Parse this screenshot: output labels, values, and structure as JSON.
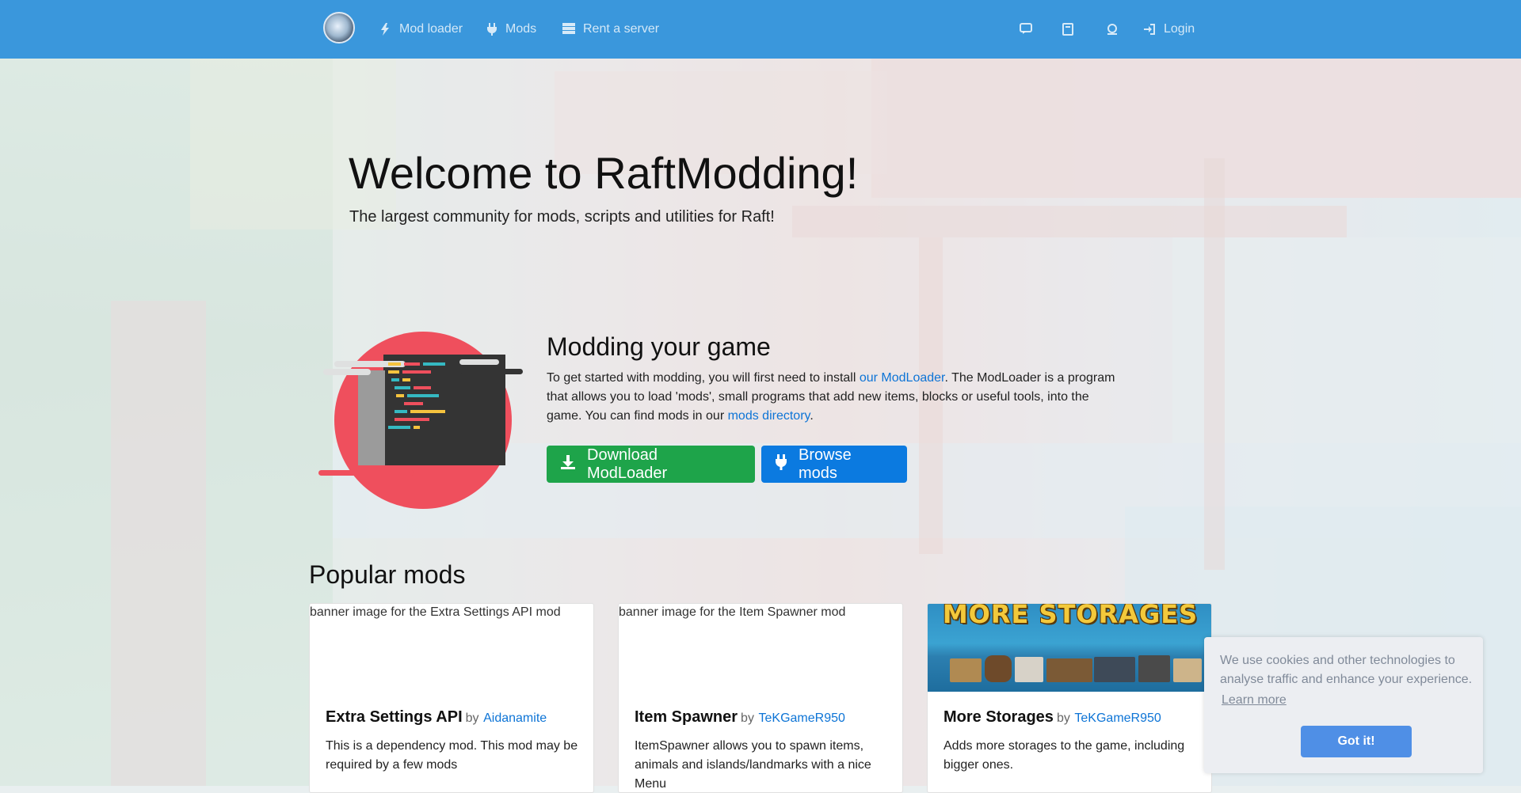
{
  "navbar": {
    "items": [
      {
        "label": "Mod loader",
        "icon": "bolt-icon"
      },
      {
        "label": "Mods",
        "icon": "plug-icon"
      },
      {
        "label": "Rent a server",
        "icon": "server-icon"
      }
    ],
    "right_icons": [
      "chat-icon",
      "book-icon",
      "support-icon"
    ],
    "login_label": "Login"
  },
  "hero": {
    "title": "Welcome to RaftModding!",
    "subtitle": "The largest community for mods, scripts and utilities for Raft!"
  },
  "modding": {
    "title": "Modding your game",
    "desc_part1": "To get started with modding, you will first need to install ",
    "link1": "our ModLoader",
    "desc_part2": ". The ModLoader is a program that allows you to load 'mods', small programs that add new items, blocks or useful tools, into the game. You can find mods in our ",
    "link2": "mods directory",
    "desc_part3": ".",
    "download_label": "Download ModLoader",
    "browse_label": "Browse mods"
  },
  "popular": {
    "title": "Popular mods",
    "by_label": "by",
    "cards": [
      {
        "image_alt": "banner image for the Extra Settings API mod",
        "name": "Extra Settings API",
        "author": "Aidanamite",
        "description": "This is a dependency mod. This mod may be required by a few mods"
      },
      {
        "image_alt": "banner image for the Item Spawner mod",
        "name": "Item Spawner",
        "author": "TeKGameR950",
        "description": "ItemSpawner allows you to spawn items, animals and islands/landmarks with a nice Menu"
      },
      {
        "banner_text": "MORE STORAGES",
        "name": "More Storages",
        "author": "TeKGameR950",
        "description": "Adds more storages to the game, including bigger ones."
      }
    ]
  },
  "cookie": {
    "message": "We use cookies and other technologies to analyse traffic and enhance your experience.",
    "learn_more": "Learn more",
    "accept": "Got it!"
  },
  "colors": {
    "navbar": "#3a97dc",
    "download_button": "#1ea44a",
    "browse_button": "#0b7ae0",
    "link": "#0d74d6",
    "cookie_button": "#4f8fe6"
  }
}
